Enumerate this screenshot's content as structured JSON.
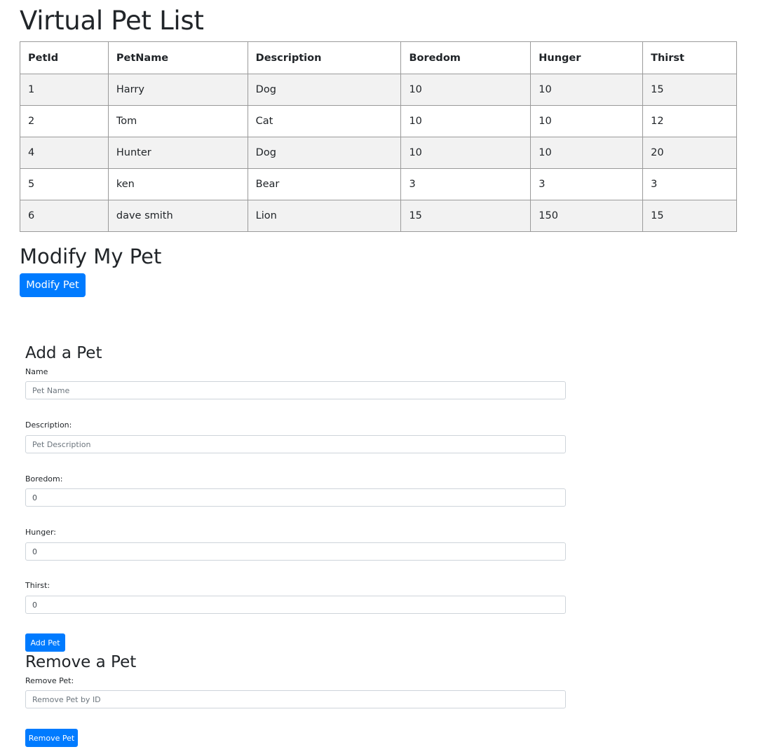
{
  "page": {
    "title": "Virtual Pet List"
  },
  "table": {
    "headers": [
      "PetId",
      "PetName",
      "Description",
      "Boredom",
      "Hunger",
      "Thirst"
    ],
    "rows": [
      [
        "1",
        "Harry",
        "Dog",
        "10",
        "10",
        "15"
      ],
      [
        "2",
        "Tom",
        "Cat",
        "10",
        "10",
        "12"
      ],
      [
        "4",
        "Hunter",
        "Dog",
        "10",
        "10",
        "20"
      ],
      [
        "5",
        "ken",
        "Bear",
        "3",
        "3",
        "3"
      ],
      [
        "6",
        "dave smith",
        "Lion",
        "15",
        "150",
        "15"
      ]
    ]
  },
  "modify": {
    "title": "Modify My Pet",
    "button_label": "Modify Pet"
  },
  "add": {
    "title": "Add a Pet",
    "name_label": "Name",
    "name_placeholder": "Pet Name",
    "description_label": "Description:",
    "description_placeholder": "Pet Description",
    "boredom_label": "Boredom:",
    "boredom_value": "0",
    "hunger_label": "Hunger:",
    "hunger_value": "0",
    "thirst_label": "Thirst:",
    "thirst_value": "0",
    "button_label": "Add Pet"
  },
  "remove": {
    "title": "Remove a Pet",
    "label": "Remove Pet:",
    "placeholder": "Remove Pet by ID",
    "button_label": "Remove Pet"
  },
  "colors": {
    "primary": "#007bff",
    "row_stripe": "#f2f2f2"
  }
}
